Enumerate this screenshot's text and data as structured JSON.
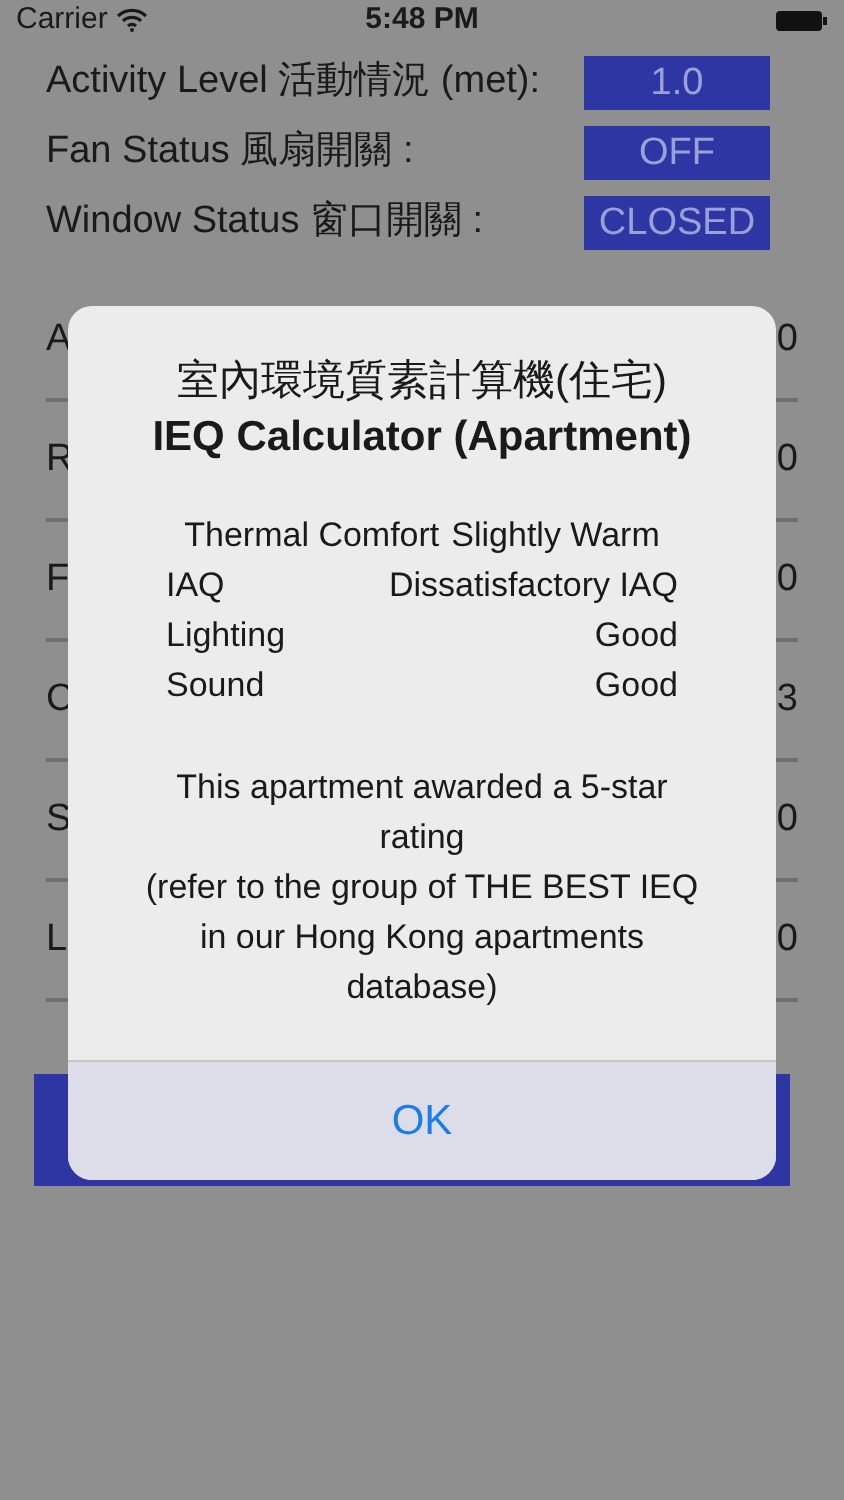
{
  "status_bar": {
    "carrier": "Carrier",
    "time": "5:48 PM"
  },
  "settings": [
    {
      "label": "Activity Level 活動情況 (met):",
      "value": "1.0"
    },
    {
      "label": "Fan Status 風扇開關 :",
      "value": "OFF"
    },
    {
      "label": "Window Status 窗口開關 :",
      "value": "CLOSED"
    }
  ],
  "background_rows": [
    {
      "column_1": "A",
      "column_2": "0"
    },
    {
      "column_1": "R",
      "column_2": "0"
    },
    {
      "column_1": "F",
      "column_2": "0"
    },
    {
      "column_1": "C",
      "column_2": "3"
    },
    {
      "column_1": "S",
      "column_2": "0"
    },
    {
      "column_1": "L",
      "column_2": "0"
    }
  ],
  "dialog": {
    "title_zh": "室內環境質素計算機(住宅)",
    "title_en": "IEQ Calculator (Apartment)",
    "results": [
      {
        "label": "Thermal Comfort",
        "value": "Slightly Warm"
      },
      {
        "label": "IAQ",
        "value": "Dissatisfactory IAQ"
      },
      {
        "label": "Lighting",
        "value": "Good"
      },
      {
        "label": "Sound",
        "value": "Good"
      }
    ],
    "message": [
      "This apartment awarded a 5-star rating",
      "(refer to the group of THE BEST IEQ in our Hong Kong apartments database)"
    ],
    "button": "OK"
  }
}
